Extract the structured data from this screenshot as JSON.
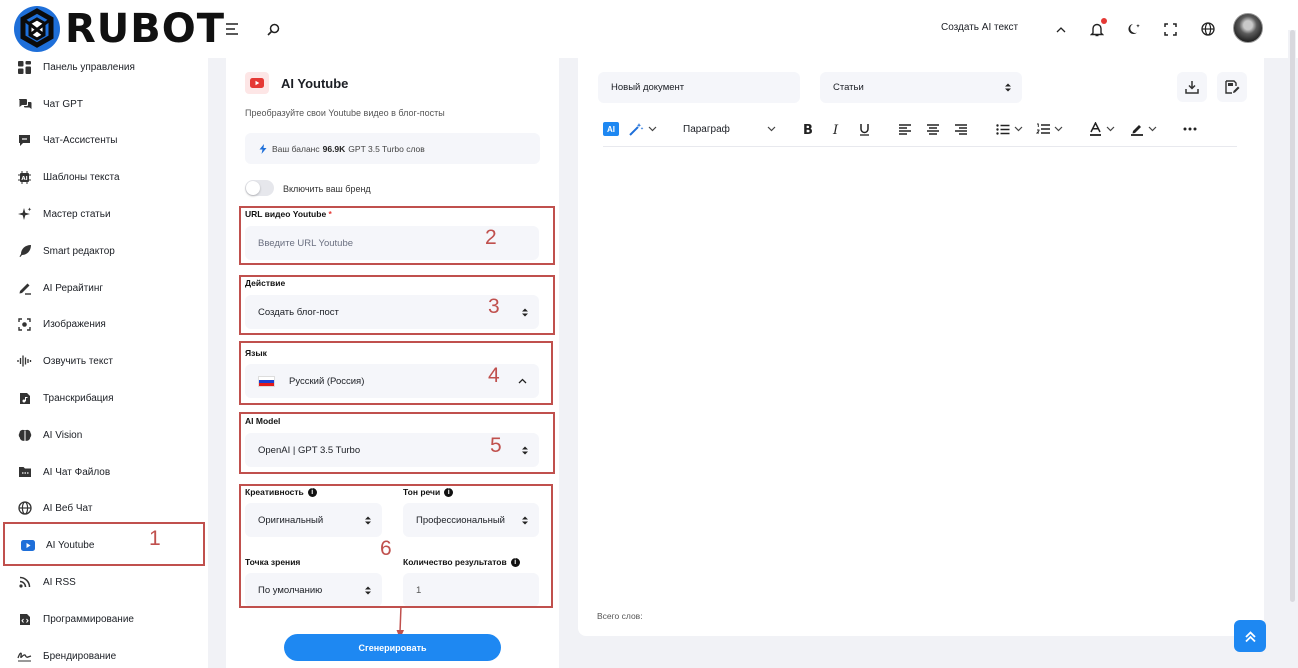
{
  "app": {
    "logo_text": "RUBOT"
  },
  "header": {
    "create_text_label": "Создать AI текст"
  },
  "sidebar": {
    "items": [
      {
        "label": "Панель управления",
        "icon": "dashboard-grid-icon"
      },
      {
        "label": "Чат GPT",
        "icon": "chat-bubbles-icon"
      },
      {
        "label": "Чат-Ассистенты",
        "icon": "assistant-chat-icon"
      },
      {
        "label": "Шаблоны текста",
        "icon": "ai-chip-icon"
      },
      {
        "label": "Мастер статьи",
        "icon": "sparkle-icon"
      },
      {
        "label": "Smart редактор",
        "icon": "feather-pen-icon"
      },
      {
        "label": "AI Рерайтинг",
        "icon": "pencil-line-icon"
      },
      {
        "label": "Изображения",
        "icon": "image-scan-icon"
      },
      {
        "label": "Озвучить текст",
        "icon": "sound-wave-icon"
      },
      {
        "label": "Транскрибация",
        "icon": "audio-file-icon"
      },
      {
        "label": "AI Vision",
        "icon": "brain-icon"
      },
      {
        "label": "AI Чат Файлов",
        "icon": "folder-chat-icon"
      },
      {
        "label": "AI Веб Чат",
        "icon": "globe-icon"
      },
      {
        "label": "AI Youtube",
        "icon": "youtube-icon"
      },
      {
        "label": "AI RSS",
        "icon": "rss-icon"
      },
      {
        "label": "Программирование",
        "icon": "code-file-icon"
      },
      {
        "label": "Брендирование",
        "icon": "signature-icon"
      }
    ]
  },
  "form": {
    "title": "AI Youtube",
    "subtitle": "Преобразуйте свои Youtube видео в блог-посты",
    "balance_prefix": "Ваш баланс",
    "balance_value": "96.9K",
    "balance_suffix": "GPT 3.5 Turbo слов",
    "brand_toggle_label": "Включить ваш бренд",
    "url_label": "URL видео Youtube",
    "url_required_mark": "*",
    "url_placeholder": "Введите URL Youtube",
    "action_label": "Действие",
    "action_value": "Создать блог-пост",
    "language_label": "Язык",
    "language_value": "Русский (Россия)",
    "model_label": "AI Model",
    "model_value": "OpenAI | GPT 3.5 Turbo",
    "creativity_label": "Креативность",
    "creativity_value": "Оригинальный",
    "tone_label": "Тон речи",
    "tone_value": "Профессиональный",
    "pov_label": "Точка зрения",
    "pov_value": "По умолчанию",
    "results_label": "Количество результатов",
    "results_value": "1",
    "generate_label": "Сгенерировать"
  },
  "annotations": [
    "1",
    "2",
    "3",
    "4",
    "5",
    "6"
  ],
  "editor": {
    "doc_name": "Новый документ",
    "category": "Статьи",
    "ai_chip": "AI",
    "paragraph_select": "Параграф",
    "word_count_label": "Всего слов:"
  },
  "colors": {
    "accent": "#1e88f2",
    "annotation": "#c0504d",
    "youtube_red": "#e53935"
  }
}
